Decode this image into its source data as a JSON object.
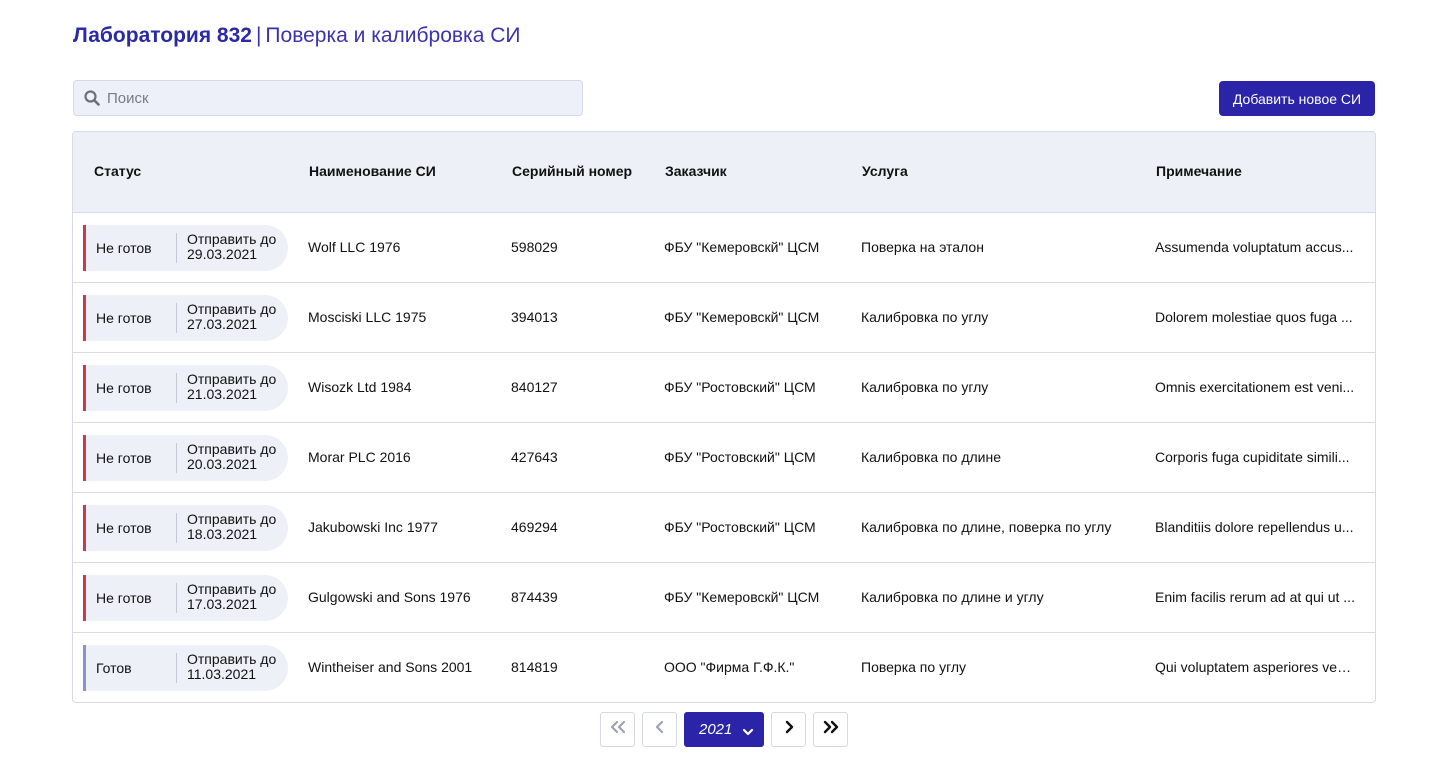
{
  "header": {
    "lab": "Лаборатория 832",
    "separator": "|",
    "section": "Поверка и калибровка СИ"
  },
  "search": {
    "placeholder": "Поиск",
    "icon": "search-icon"
  },
  "toolbar": {
    "add_label": "Добавить новое СИ"
  },
  "colors": {
    "accent": "#2b24a8",
    "not_ready": "#c93a4a",
    "ready": "#8f8fd6"
  },
  "table": {
    "columns": [
      "Статус",
      "Наименование СИ",
      "Серийный номер",
      "Заказчик",
      "Услуга",
      "Примечание"
    ],
    "rows": [
      {
        "status": "Не готов",
        "ready": false,
        "send_label": "Отправить до",
        "send_date": "29.03.2021",
        "name": "Wolf LLC 1976",
        "serial": "598029",
        "customer": "ФБУ \"Кемеровскй\" ЦСМ",
        "service": "Поверка на эталон",
        "note": "Assumenda voluptatum accus..."
      },
      {
        "status": "Не готов",
        "ready": false,
        "send_label": "Отправить до",
        "send_date": "27.03.2021",
        "name": "Mosciski LLC 1975",
        "serial": "394013",
        "customer": "ФБУ \"Кемеровскй\" ЦСМ",
        "service": "Калибровка по углу",
        "note": "Dolorem molestiae quos fuga ..."
      },
      {
        "status": "Не готов",
        "ready": false,
        "send_label": "Отправить до",
        "send_date": "21.03.2021",
        "name": "Wisozk Ltd 1984",
        "serial": "840127",
        "customer": "ФБУ \"Ростовский\" ЦСМ",
        "service": "Калибровка по углу",
        "note": "Omnis exercitationem est veni..."
      },
      {
        "status": "Не готов",
        "ready": false,
        "send_label": "Отправить до",
        "send_date": "20.03.2021",
        "name": "Morar PLC 2016",
        "serial": "427643",
        "customer": "ФБУ \"Ростовский\" ЦСМ",
        "service": "Калибровка по длине",
        "note": "Corporis fuga cupiditate simili..."
      },
      {
        "status": "Не готов",
        "ready": false,
        "send_label": "Отправить до",
        "send_date": "18.03.2021",
        "name": "Jakubowski Inc 1977",
        "serial": "469294",
        "customer": "ФБУ \"Ростовский\" ЦСМ",
        "service": "Калибровка по длине, поверка по углу",
        "note": "Blanditiis dolore repellendus u..."
      },
      {
        "status": "Не готов",
        "ready": false,
        "send_label": "Отправить до",
        "send_date": "17.03.2021",
        "name": "Gulgowski and Sons 1976",
        "serial": "874439",
        "customer": "ФБУ \"Кемеровскй\" ЦСМ",
        "service": "Калибровка по длине и углу",
        "note": "Enim facilis rerum ad at qui ut ..."
      },
      {
        "status": "Готов",
        "ready": true,
        "send_label": "Отправить до",
        "send_date": "11.03.2021",
        "name": "Wintheiser and Sons 2001",
        "serial": "814819",
        "customer": "ООО \"Фирма Г.Ф.К.\"",
        "service": "Поверка по углу",
        "note": "Qui voluptatem asperiores ven..."
      }
    ]
  },
  "pagination": {
    "year": "2021",
    "icons": [
      "first-page-icon",
      "prev-page-icon",
      "chevron-down-icon",
      "next-page-icon",
      "last-page-icon"
    ]
  }
}
